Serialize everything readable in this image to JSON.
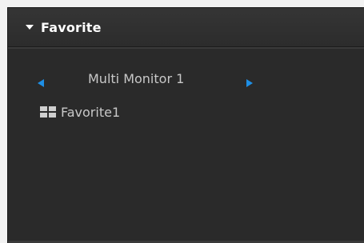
{
  "panel": {
    "title": "Favorite",
    "toggle_icon": "triangle-down-icon",
    "accent_color": "#1e8fe6"
  },
  "monitor_nav": {
    "label": "Multi Monitor 1",
    "prev_icon": "arrow-left-icon",
    "next_icon": "arrow-right-icon"
  },
  "favorites": [
    {
      "label": "Favorite1",
      "icon": "layout-grid-icon"
    }
  ]
}
